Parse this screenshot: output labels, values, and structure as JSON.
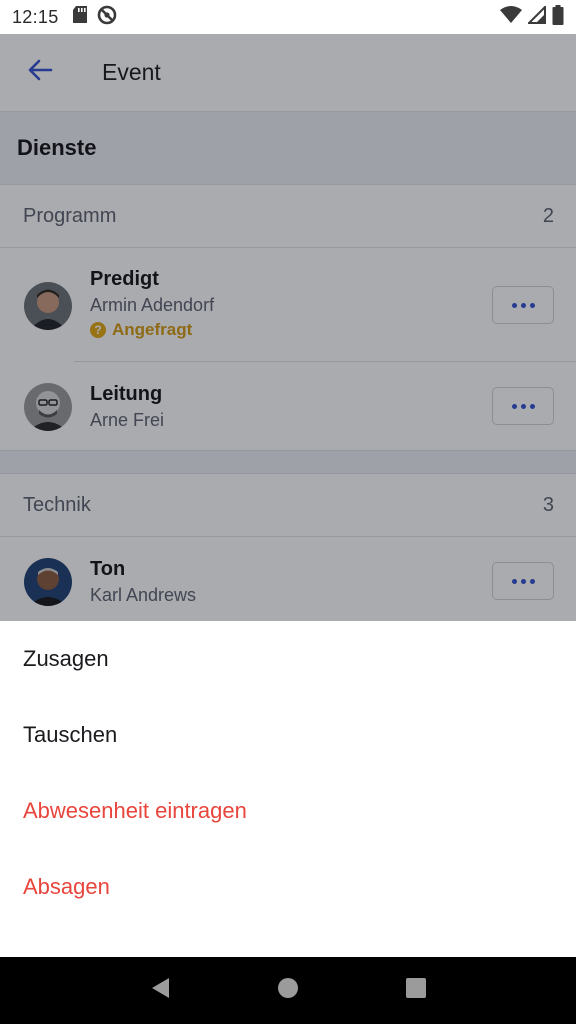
{
  "status_bar": {
    "time": "12:15",
    "left_icons": [
      "sd-card-icon",
      "no-disturb-icon"
    ],
    "right_icons": [
      "wifi-icon",
      "cell-signal-icon",
      "battery-icon"
    ]
  },
  "app_bar": {
    "title": "Event",
    "back_icon": "arrow-left-icon",
    "accent_color": "#2f4fd0"
  },
  "section": {
    "title": "Dienste"
  },
  "groups": [
    {
      "name": "Programm",
      "count": "2",
      "duties": [
        {
          "title": "Predigt",
          "person": "Armin Adendorf",
          "status": "Angefragt",
          "status_color": "#d49a10"
        },
        {
          "title": "Leitung",
          "person": "Arne Frei"
        }
      ]
    },
    {
      "name": "Technik",
      "count": "3",
      "duties": [
        {
          "title": "Ton",
          "person": "Karl Andrews"
        }
      ]
    }
  ],
  "action_sheet": {
    "items": [
      {
        "label": "Zusagen",
        "style": "normal"
      },
      {
        "label": "Tauschen",
        "style": "normal"
      },
      {
        "label": "Abwesenheit eintragen",
        "style": "danger"
      },
      {
        "label": "Absagen",
        "style": "danger"
      }
    ],
    "danger_color": "#e8453c"
  },
  "nav_bar": {
    "icons": [
      "back-triangle-icon",
      "home-circle-icon",
      "recents-square-icon"
    ]
  }
}
